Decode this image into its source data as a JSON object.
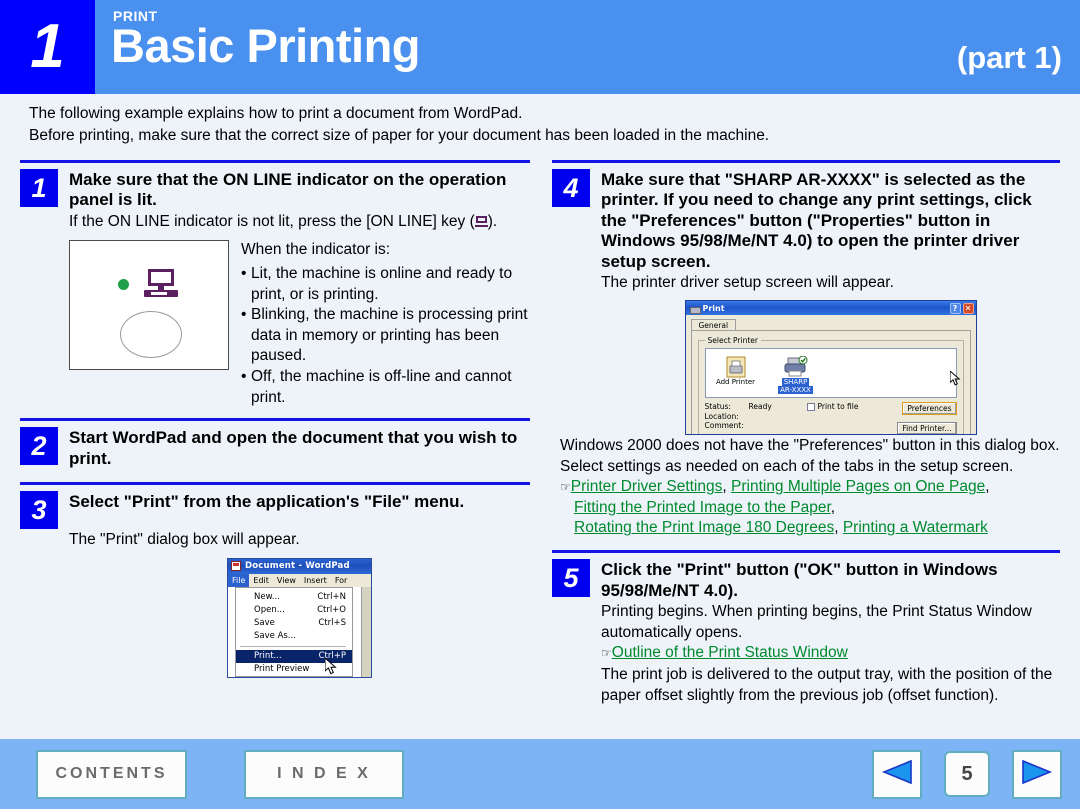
{
  "header": {
    "chapter_number": "1",
    "kicker": "PRINT",
    "title": "Basic Printing",
    "part": "(part 1)",
    "colors": {
      "number_box": "#0000ff",
      "bar": "#4a90ee",
      "text": "#ffffff"
    }
  },
  "intro": {
    "line1": "The following example explains how to print a document from WordPad.",
    "line2": "Before printing, make sure that the correct size of paper for your document has been loaded in the machine."
  },
  "steps": {
    "step1": {
      "number": "1",
      "title": "Make sure that the ON LINE indicator on the operation panel is lit.",
      "body_a": "If the ON LINE indicator is not lit, press the [ON LINE] key (",
      "body_b": ").",
      "icon_name": "online-key-monitor-icon",
      "bullets_lead": "When the indicator is:",
      "bullets": [
        "Lit, the machine is online and ready to print, or is printing.",
        "Blinking, the machine is processing print data in memory or printing has been paused.",
        "Off, the machine is off-line and cannot print."
      ]
    },
    "step2": {
      "number": "2",
      "title": "Start WordPad and open the document that you wish to print."
    },
    "step3": {
      "number": "3",
      "title": "Select \"Print\" from the application's \"File\" menu.",
      "body": "The \"Print\" dialog box will appear."
    },
    "step4": {
      "number": "4",
      "title": "Make sure that \"SHARP AR-XXXX\" is selected as the printer. If you need to change any print settings, click the \"Preferences\" button (\"Properties\" button in Windows 95/98/Me/NT 4.0) to open the printer driver setup screen.",
      "body": "The printer driver setup screen will appear.",
      "note": "Windows 2000 does not have the \"Preferences\" button in this dialog box. Select settings as needed on each of the tabs in the setup screen.",
      "links": [
        "Printer Driver Settings",
        "Printing Multiple Pages on One Page",
        "Fitting the Printed Image to the Paper",
        "Rotating the Print Image 180 Degrees",
        "Printing a Watermark"
      ]
    },
    "step5": {
      "number": "5",
      "title": "Click the \"Print\" button (\"OK\" button in Windows 95/98/Me/NT 4.0).",
      "body": "Printing begins. When printing begins, the Print Status Window automatically opens.",
      "link": "Outline of the Print Status Window",
      "body2": "The print job is delivered to the output tray, with the position of the paper offset slightly from the previous job (offset function)."
    }
  },
  "wordpad": {
    "title": "Document - WordPad",
    "icon_name": "wordpad-icon",
    "menubar": [
      "File",
      "Edit",
      "View",
      "Insert",
      "For"
    ],
    "menu_items": [
      {
        "label": "New...",
        "shortcut": "Ctrl+N"
      },
      {
        "label": "Open...",
        "shortcut": "Ctrl+O"
      },
      {
        "label": "Save",
        "shortcut": "Ctrl+S"
      },
      {
        "label": "Save As...",
        "shortcut": ""
      },
      {
        "label": "Print...",
        "shortcut": "Ctrl+P"
      },
      {
        "label": "Print Preview",
        "shortcut": ""
      }
    ],
    "selected_item": "Print..."
  },
  "print_dialog": {
    "title": "Print",
    "tab": "General",
    "group_label": "Select Printer",
    "printers": [
      {
        "name": "Add Printer",
        "selected": false
      },
      {
        "name_line1": "SHARP",
        "name_line2": "AR-XXXX",
        "selected": true
      }
    ],
    "status_label": "Status:",
    "status_value": "Ready",
    "location_label": "Location:",
    "comment_label": "Comment:",
    "print_to_file": "Print to file",
    "preferences_button": "Preferences",
    "find_printer_button": "Find Printer..."
  },
  "footer": {
    "contents": "CONTENTS",
    "index": "I N D E X",
    "page": "5",
    "prev_icon": "previous-page-arrow-icon",
    "next_icon": "next-page-arrow-icon",
    "bar_color": "#7db4f5"
  }
}
